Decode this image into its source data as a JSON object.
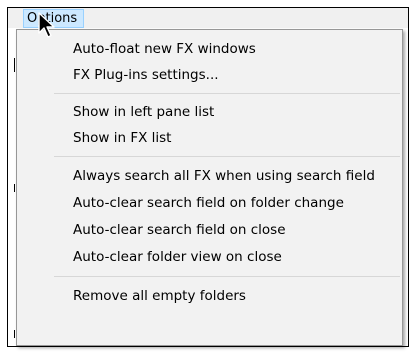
{
  "menu": {
    "title": "Options",
    "items": [
      {
        "label": "Auto-float new FX windows"
      },
      {
        "label": "FX Plug-ins settings..."
      },
      {
        "label": "Show in left pane list"
      },
      {
        "label": "Show in FX list"
      },
      {
        "label": "Always search all FX when using search field"
      },
      {
        "label": "Auto-clear search field on folder change"
      },
      {
        "label": "Auto-clear search field on close"
      },
      {
        "label": "Auto-clear folder view on close"
      },
      {
        "label": "Remove all empty folders"
      }
    ]
  },
  "colors": {
    "menu_highlight": "#cce8ff",
    "menu_background": "#f2f2f2",
    "separator": "#d7d7d7"
  },
  "icons": {
    "cursor": "arrow-cursor-icon"
  }
}
